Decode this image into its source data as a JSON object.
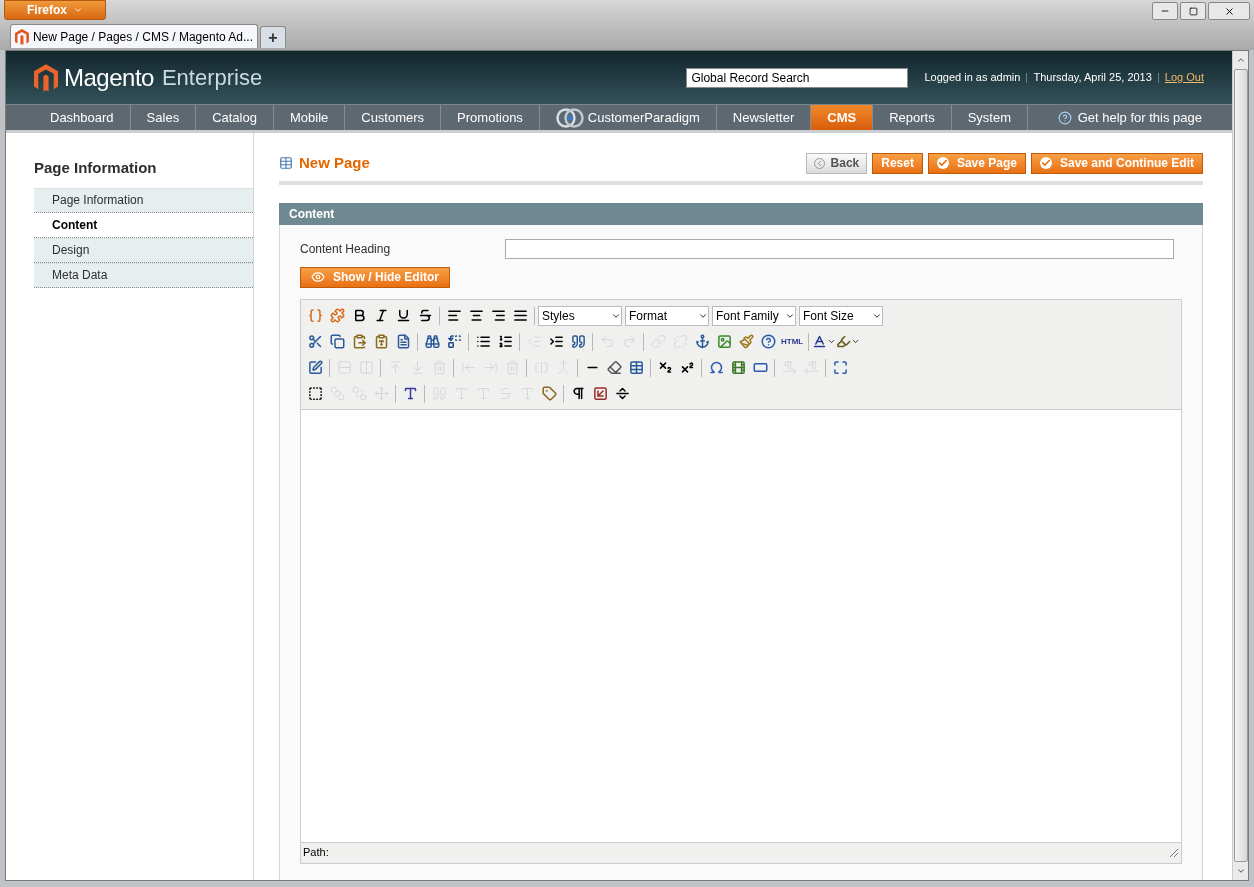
{
  "browser": {
    "menu_button": "Firefox",
    "tab_title": "New Page / Pages / CMS / Magento Ad...",
    "new_tab": "+"
  },
  "header": {
    "logo_brand": "Magento",
    "logo_suffix": "Enterprise",
    "search": {
      "value": "Global Record Search"
    },
    "user": "Logged in as admin",
    "date": "Thursday, April 25, 2013",
    "logout": "Log Out"
  },
  "nav": {
    "items": [
      {
        "label": "Dashboard",
        "kind": "text",
        "selected": false
      },
      {
        "label": "Sales",
        "kind": "text",
        "selected": false
      },
      {
        "label": "Catalog",
        "kind": "text",
        "selected": false
      },
      {
        "label": "Mobile",
        "kind": "text",
        "selected": false
      },
      {
        "label": "Customers",
        "kind": "text",
        "selected": false
      },
      {
        "label": "Promotions",
        "kind": "text",
        "selected": false
      },
      {
        "label": "CustomerParadigm",
        "kind": "logo",
        "selected": false
      },
      {
        "label": "Newsletter",
        "kind": "text",
        "selected": false
      },
      {
        "label": "CMS",
        "kind": "text",
        "selected": true
      },
      {
        "label": "Reports",
        "kind": "text",
        "selected": false
      },
      {
        "label": "System",
        "kind": "text",
        "selected": false
      }
    ],
    "help": "Get help for this page"
  },
  "sidebar": {
    "title": "Page Information",
    "tabs": [
      {
        "label": "Page Information",
        "selected": false
      },
      {
        "label": "Content",
        "selected": true
      },
      {
        "label": "Design",
        "selected": false
      },
      {
        "label": "Meta Data",
        "selected": false
      }
    ]
  },
  "page": {
    "title": "New Page",
    "buttons": [
      {
        "label": "Back",
        "kind": "back"
      },
      {
        "label": "Reset",
        "kind": "plain"
      },
      {
        "label": "Save Page",
        "kind": "save"
      },
      {
        "label": "Save and Continue Edit",
        "kind": "save"
      }
    ]
  },
  "section": {
    "title": "Content",
    "fields": [
      {
        "label": "Content Heading"
      }
    ],
    "toggle_editor": "Show / Hide Editor",
    "editor": {
      "toolbar_rows": [
        [
          {
            "kind": "variable",
            "disabled": false
          },
          {
            "kind": "widget",
            "disabled": false
          },
          {
            "kind": "bold",
            "disabled": false
          },
          {
            "kind": "italic",
            "disabled": false
          },
          {
            "kind": "underline",
            "disabled": false
          },
          {
            "kind": "strikethrough",
            "disabled": false
          },
          {
            "kind": "sep"
          },
          {
            "kind": "align-left",
            "disabled": false
          },
          {
            "kind": "align-center",
            "disabled": false
          },
          {
            "kind": "align-right",
            "disabled": false
          },
          {
            "kind": "justify",
            "disabled": false
          },
          {
            "kind": "sep"
          },
          {
            "kind": "select",
            "label": "Styles"
          },
          {
            "kind": "select",
            "label": "Format"
          },
          {
            "kind": "select",
            "label": "Font Family"
          },
          {
            "kind": "select",
            "label": "Font Size"
          }
        ],
        [
          {
            "kind": "cut",
            "disabled": false
          },
          {
            "kind": "copy",
            "disabled": false
          },
          {
            "kind": "paste",
            "disabled": false
          },
          {
            "kind": "paste-text",
            "disabled": false
          },
          {
            "kind": "paste-word",
            "disabled": false
          },
          {
            "kind": "sep"
          },
          {
            "kind": "find",
            "disabled": false
          },
          {
            "kind": "replace",
            "disabled": false
          },
          {
            "kind": "sep"
          },
          {
            "kind": "bullet-list",
            "disabled": false
          },
          {
            "kind": "numbered-list",
            "disabled": false
          },
          {
            "kind": "sep"
          },
          {
            "kind": "outdent",
            "disabled": true
          },
          {
            "kind": "indent",
            "disabled": false
          },
          {
            "kind": "blockquote",
            "disabled": false
          },
          {
            "kind": "sep"
          },
          {
            "kind": "undo",
            "disabled": true
          },
          {
            "kind": "redo",
            "disabled": true
          },
          {
            "kind": "sep"
          },
          {
            "kind": "link",
            "disabled": true
          },
          {
            "kind": "unlink",
            "disabled": true
          },
          {
            "kind": "anchor",
            "disabled": false
          },
          {
            "kind": "image",
            "disabled": false
          },
          {
            "kind": "cleanup",
            "disabled": false
          },
          {
            "kind": "help",
            "disabled": false
          },
          {
            "kind": "html",
            "label": "HTML",
            "disabled": false
          },
          {
            "kind": "sep"
          },
          {
            "kind": "text-color",
            "disabled": false
          },
          {
            "kind": "highlight",
            "disabled": false
          }
        ],
        [
          {
            "kind": "table-edit",
            "disabled": false
          },
          {
            "kind": "sep"
          },
          {
            "kind": "row-props",
            "disabled": true
          },
          {
            "kind": "cell-props",
            "disabled": true
          },
          {
            "kind": "sep"
          },
          {
            "kind": "row-before",
            "disabled": true
          },
          {
            "kind": "row-after",
            "disabled": true
          },
          {
            "kind": "delete-row",
            "disabled": true
          },
          {
            "kind": "sep"
          },
          {
            "kind": "col-before",
            "disabled": true
          },
          {
            "kind": "col-after",
            "disabled": true
          },
          {
            "kind": "delete-col",
            "disabled": true
          },
          {
            "kind": "sep"
          },
          {
            "kind": "split-cells",
            "disabled": true
          },
          {
            "kind": "merge-cells",
            "disabled": true
          },
          {
            "kind": "sep"
          },
          {
            "kind": "hr",
            "disabled": false
          },
          {
            "kind": "eraser",
            "disabled": false
          },
          {
            "kind": "table",
            "disabled": false
          },
          {
            "kind": "sep"
          },
          {
            "kind": "subscript",
            "disabled": false
          },
          {
            "kind": "superscript",
            "disabled": false
          },
          {
            "kind": "sep"
          },
          {
            "kind": "omega",
            "disabled": false
          },
          {
            "kind": "media",
            "disabled": false
          },
          {
            "kind": "advanced-hr",
            "disabled": false
          },
          {
            "kind": "sep"
          },
          {
            "kind": "ltr",
            "disabled": true
          },
          {
            "kind": "rtl",
            "disabled": true
          },
          {
            "kind": "sep"
          },
          {
            "kind": "fullscreen",
            "disabled": false
          }
        ],
        [
          {
            "kind": "visual-aid",
            "disabled": false
          },
          {
            "kind": "forward",
            "disabled": true
          },
          {
            "kind": "backward",
            "disabled": true
          },
          {
            "kind": "absolute",
            "disabled": true
          },
          {
            "kind": "sep"
          },
          {
            "kind": "style-props",
            "disabled": false
          },
          {
            "kind": "sep"
          },
          {
            "kind": "cite",
            "disabled": true
          },
          {
            "kind": "abbr",
            "disabled": true
          },
          {
            "kind": "acronym",
            "disabled": true
          },
          {
            "kind": "del",
            "disabled": true
          },
          {
            "kind": "ins",
            "disabled": true
          },
          {
            "kind": "attribs",
            "disabled": false
          },
          {
            "kind": "sep"
          },
          {
            "kind": "pilcrow",
            "disabled": false
          },
          {
            "kind": "nonbreaking",
            "disabled": false
          },
          {
            "kind": "pagebreak",
            "disabled": false
          }
        ]
      ],
      "path_label": "Path:"
    }
  }
}
